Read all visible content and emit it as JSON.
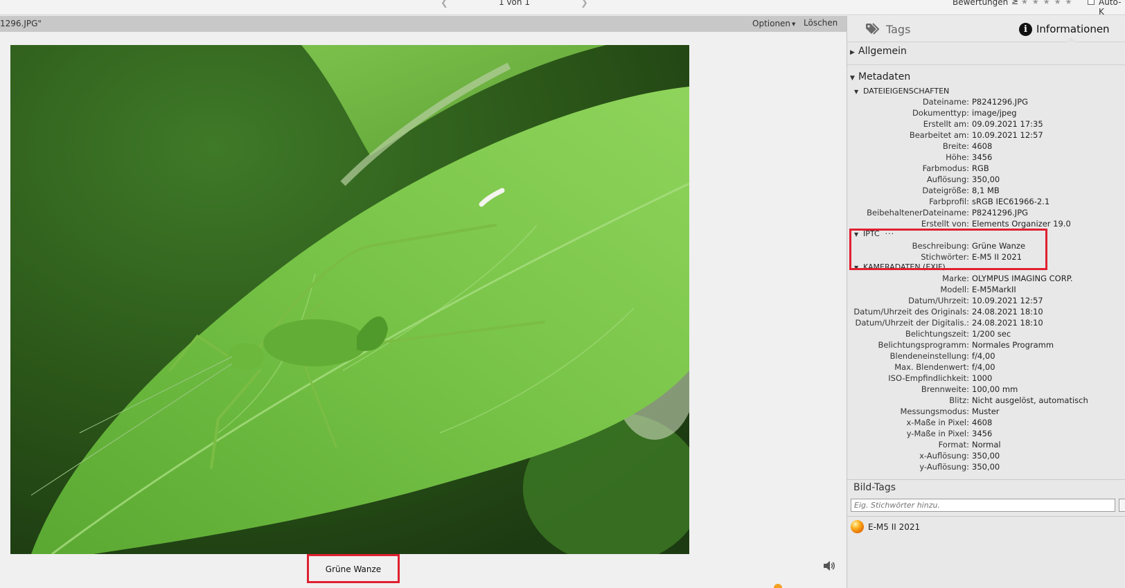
{
  "topbar": {
    "pager": "1 von 1",
    "ratings_label": "Bewertungen",
    "ratings_operator": "≥",
    "stars": "★★★★★",
    "autok_label": "Auto-K"
  },
  "viewer": {
    "filename": "1296.JPG\"",
    "options_label": "Optionen",
    "delete_label": "Löschen",
    "caption": "Grüne Wanze"
  },
  "panel": {
    "tab_tags": "Tags",
    "tab_info": "Informationen",
    "section_general": "Allgemein",
    "section_metadata": "Metadaten",
    "file_props_title": "DATEIEIGENSCHAFTEN",
    "file_props": [
      {
        "k": "Dateiname:",
        "v": "P8241296.JPG"
      },
      {
        "k": "Dokumenttyp:",
        "v": "image/jpeg"
      },
      {
        "k": "Erstellt am:",
        "v": "09.09.2021 17:35"
      },
      {
        "k": "Bearbeitet am:",
        "v": "10.09.2021 12:57"
      },
      {
        "k": "Breite:",
        "v": "4608"
      },
      {
        "k": "Höhe:",
        "v": "3456"
      },
      {
        "k": "Farbmodus:",
        "v": "RGB"
      },
      {
        "k": "Auflösung:",
        "v": "350,00"
      },
      {
        "k": "Dateigröße:",
        "v": "8,1 MB"
      },
      {
        "k": "Farbprofil:",
        "v": "sRGB IEC61966-2.1"
      },
      {
        "k": "BeibehaltenerDateiname:",
        "v": "P8241296.JPG"
      },
      {
        "k": "Erstellt von:",
        "v": "Elements Organizer 19.0"
      }
    ],
    "iptc_title": "IPTC",
    "iptc_dots": "···",
    "iptc": [
      {
        "k": "Beschreibung:",
        "v": "Grüne Wanze"
      },
      {
        "k": "Stichwörter:",
        "v": "E-M5 II 2021"
      }
    ],
    "exif_title": "KAMERADATEN (EXIF)",
    "exif": [
      {
        "k": "Marke:",
        "v": "OLYMPUS IMAGING CORP."
      },
      {
        "k": "Modell:",
        "v": "E-M5MarkII"
      },
      {
        "k": "Datum/Uhrzeit:",
        "v": "10.09.2021 12:57"
      },
      {
        "k": "Datum/Uhrzeit des Originals:",
        "v": "24.08.2021 18:10"
      },
      {
        "k": "Datum/Uhrzeit der Digitalis.:",
        "v": "24.08.2021 18:10"
      },
      {
        "k": "Belichtungszeit:",
        "v": "1/200 sec"
      },
      {
        "k": "Belichtungsprogramm:",
        "v": "Normales Programm"
      },
      {
        "k": "Blendeneinstellung:",
        "v": "f/4,00"
      },
      {
        "k": "Max. Blendenwert:",
        "v": "f/4,00"
      },
      {
        "k": "ISO-Empfindlichkeit:",
        "v": "1000"
      },
      {
        "k": "Brennweite:",
        "v": "100,00 mm"
      },
      {
        "k": "Blitz:",
        "v": "Nicht ausgelöst, automatisch"
      },
      {
        "k": "Messungsmodus:",
        "v": "Muster"
      },
      {
        "k": "x-Maße in Pixel:",
        "v": "4608"
      },
      {
        "k": "y-Maße in Pixel:",
        "v": "3456"
      },
      {
        "k": "Format:",
        "v": "Normal"
      },
      {
        "k": "x-Auflösung:",
        "v": "350,00"
      },
      {
        "k": "y-Auflösung:",
        "v": "350,00"
      }
    ],
    "bild_tags_title": "Bild-Tags",
    "tag_input_placeholder": "Eig. Stichwörter hinzu.",
    "tags": [
      "E-M5 II 2021"
    ]
  },
  "colors": {
    "highlight_box": "#e02030",
    "leaf_green": "#6cb83c",
    "tag_orange": "#f08a10"
  },
  "icons": {
    "prev": "chevron-left-icon",
    "next": "chevron-right-icon",
    "tags": "tag-icon",
    "info": "info-icon",
    "speaker": "speaker-icon",
    "tag_ball": "keyword-tag-icon"
  }
}
